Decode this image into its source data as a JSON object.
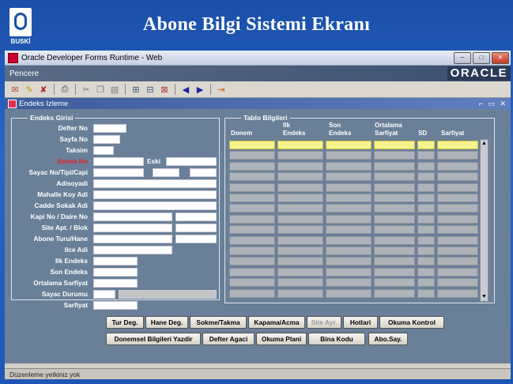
{
  "slide": {
    "title": "Abone Bilgi Sistemi Ekranı",
    "logo_text": "BUSKİ"
  },
  "window": {
    "title": "Oracle Developer Forms Runtime - Web",
    "menu": "Pencere",
    "brand": "ORACLE",
    "inner_title": "Endeks Izleme"
  },
  "left": {
    "legend": "Endeks Girisi",
    "labels": [
      "Defter No",
      "Sayfa No",
      "Taksim",
      "Abone No",
      "Sayac No/Tipi/Capi",
      "Adisoyadi",
      "Mahalle Koy Adi",
      "Cadde Sokak Adi",
      "Kapi No / Daire No",
      "Site Apt. / Blok",
      "Abone Turu/Hane",
      "Ilce Adi",
      "Ilk Endeks",
      "Son Endeks",
      "Ortalama Sarfiyat",
      "Sayac Durumu",
      "Sarfiyat"
    ],
    "eski_label": "Eski"
  },
  "right": {
    "legend": "Tablo Bilgileri",
    "col1": "Donem",
    "col2": "Ilk\nEndeks",
    "col3": "Son\nEndeks",
    "col4": "Ortalama\nSarfiyat",
    "col5": "SD",
    "col6": "Sarfiyat"
  },
  "buttons": {
    "row1": [
      "Tur Deg.",
      "Hane Deg.",
      "Sokme/Takma",
      "Kapama/Acma",
      "Site Ayr.",
      "Hotlari",
      "Okuma Kontrol"
    ],
    "row2": [
      "Donemsel Bilgileri Yazdir",
      "Defter Agaci",
      "Okuma Plani",
      "Bina Kodu",
      "Abo.Say."
    ]
  },
  "status": "Düzenleme yetkiniz yok"
}
